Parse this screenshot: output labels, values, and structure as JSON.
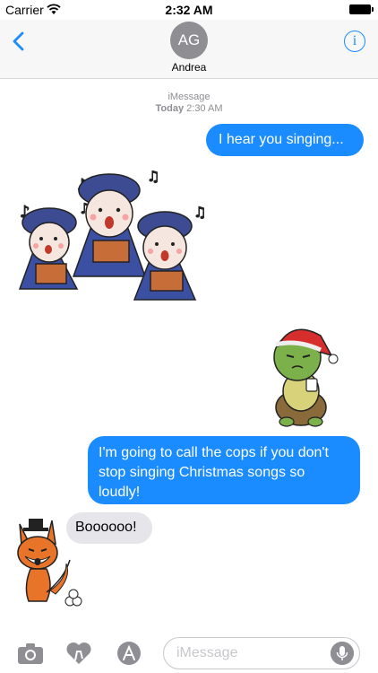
{
  "status_bar": {
    "carrier": "Carrier",
    "time": "2:32 AM"
  },
  "header": {
    "avatar_initials": "AG",
    "contact_name": "Andrea"
  },
  "conversation": {
    "service": "iMessage",
    "date_label": "Today",
    "date_time": "2:30 AM",
    "messages": [
      {
        "kind": "text",
        "direction": "outgoing",
        "text": "I hear you singing..."
      },
      {
        "kind": "sticker",
        "direction": "incoming",
        "sticker": "caroling-sheep-trio"
      },
      {
        "kind": "sticker",
        "direction": "outgoing",
        "sticker": "grumpy-turtle-santa-hat"
      },
      {
        "kind": "text",
        "direction": "outgoing",
        "text": "I'm going to call the cops if you don't stop singing Christmas songs so loudly!"
      },
      {
        "kind": "text",
        "direction": "incoming",
        "text": "Boooooo!"
      },
      {
        "kind": "sticker",
        "direction": "incoming",
        "sticker": "booing-fox"
      }
    ]
  },
  "compose": {
    "placeholder": "iMessage"
  },
  "colors": {
    "accent": "#1a8cff",
    "incoming_bubble": "#e5e5ea",
    "avatar": "#8e8e93"
  },
  "icons": [
    "wifi-icon",
    "battery-icon",
    "back-chevron-icon",
    "info-icon",
    "camera-icon",
    "digital-touch-heart-icon",
    "app-store-icon",
    "microphone-icon"
  ]
}
